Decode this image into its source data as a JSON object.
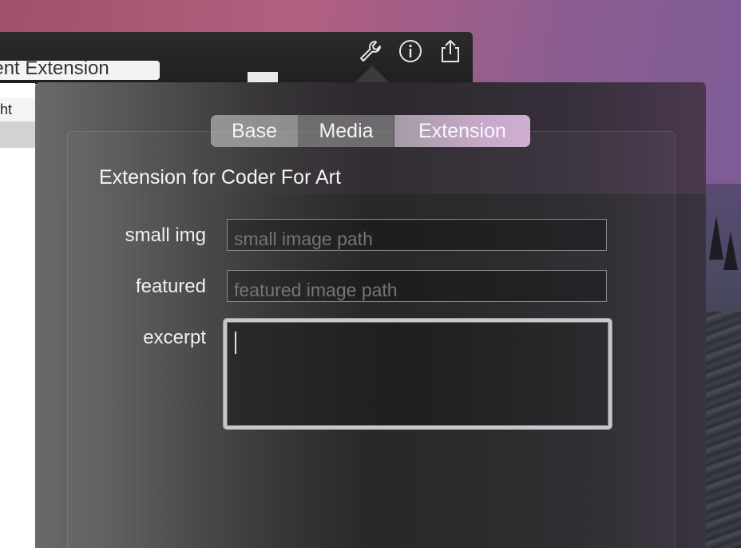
{
  "background_window": {
    "title_field_text": "ument Extension",
    "sidebar_row_text": "ht",
    "toolbar": {
      "icons": [
        "wrench-icon",
        "info-icon",
        "share-icon"
      ]
    }
  },
  "popover": {
    "tabs": [
      {
        "label": "Base",
        "selected": false
      },
      {
        "label": "Media",
        "selected": false
      },
      {
        "label": "Extension",
        "selected": true
      }
    ],
    "section_title": "Extension for Coder For Art",
    "fields": {
      "small_img": {
        "label": "small img",
        "placeholder": "small image path",
        "value": ""
      },
      "featured": {
        "label": "featured",
        "placeholder": "featured image path",
        "value": ""
      },
      "excerpt": {
        "label": "excerpt",
        "value": ""
      }
    }
  },
  "colors": {
    "accent_selected_tab": "#c4a9c6",
    "popover_dark": "#222222",
    "desktop_pink": "#b35f80"
  }
}
